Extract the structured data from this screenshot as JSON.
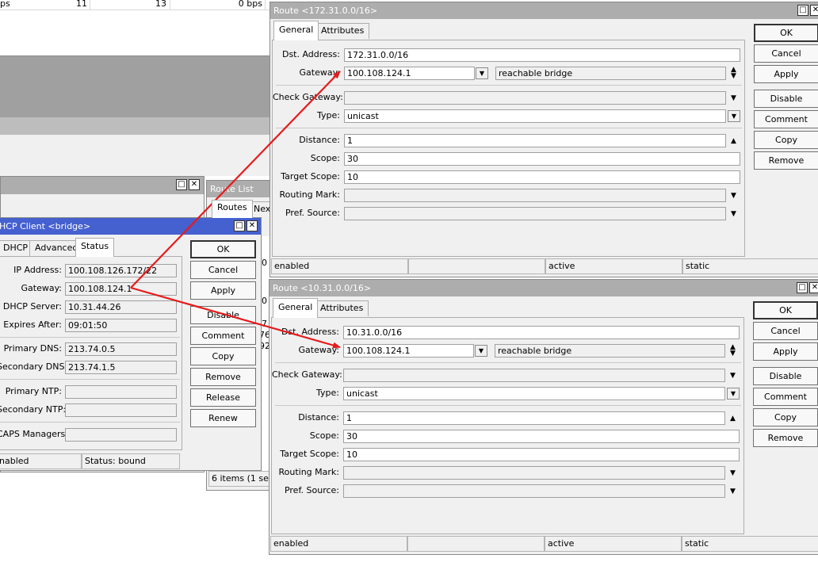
{
  "traffic_row": {
    "unit_tail": "ps",
    "v1": "11",
    "v2": "13",
    "v3": "0 bps"
  },
  "dhcp": {
    "title": "HCP Client <bridge>",
    "tabs": [
      "DHCP",
      "Advanced",
      "Status"
    ],
    "fields": [
      {
        "label": "IP Address:",
        "value": "100.108.126.172/22"
      },
      {
        "label": "Gateway:",
        "value": "100.108.124.1"
      },
      {
        "label": "DHCP Server:",
        "value": "10.31.44.26"
      },
      {
        "label": "Expires After:",
        "value": "09:01:50"
      },
      {
        "label": "Primary DNS:",
        "value": "213.74.0.5"
      },
      {
        "label": "Secondary DNS:",
        "value": "213.74.1.5"
      },
      {
        "label": "Primary NTP:",
        "value": ""
      },
      {
        "label": "Secondary NTP:",
        "value": ""
      },
      {
        "label": "CAPS Managers:",
        "value": ""
      }
    ],
    "buttons": [
      "OK",
      "Cancel",
      "Apply",
      "Disable",
      "Comment",
      "Copy",
      "Remove",
      "Release",
      "Renew"
    ],
    "status_left": "nabled",
    "status_right": "Status: bound"
  },
  "route_list": {
    "title": "Route List",
    "tabs": [
      "Routes",
      "Nex"
    ],
    "frag": [
      "0",
      "0",
      "7",
      "76",
      "92"
    ],
    "status": "6 items (1 selec"
  },
  "route_windows": [
    {
      "title": "Route <172.31.0.0/16>",
      "tabs": [
        "General",
        "Attributes"
      ],
      "dst_label": "Dst. Address:",
      "dst": "172.31.0.0/16",
      "gw_label": "Gateway:",
      "gw": "100.108.124.1",
      "gw_state": "reachable bridge",
      "check_gw_label": "Check Gateway:",
      "check_gw": "",
      "type_label": "Type:",
      "type": "unicast",
      "distance_label": "Distance:",
      "distance": "1",
      "scope_label": "Scope:",
      "scope": "30",
      "target_scope_label": "Target Scope:",
      "target_scope": "10",
      "routing_mark_label": "Routing Mark:",
      "routing_mark": "",
      "pref_source_label": "Pref. Source:",
      "pref_source": "",
      "buttons": [
        "OK",
        "Cancel",
        "Apply",
        "Disable",
        "Comment",
        "Copy",
        "Remove"
      ],
      "status": [
        "enabled",
        "",
        "active",
        "static"
      ]
    },
    {
      "title": "Route <10.31.0.0/16>",
      "tabs": [
        "General",
        "Attributes"
      ],
      "dst_label": "Dst. Address:",
      "dst": "10.31.0.0/16",
      "gw_label": "Gateway:",
      "gw": "100.108.124.1",
      "gw_state": "reachable bridge",
      "check_gw_label": "Check Gateway:",
      "check_gw": "",
      "type_label": "Type:",
      "type": "unicast",
      "distance_label": "Distance:",
      "distance": "1",
      "scope_label": "Scope:",
      "scope": "30",
      "target_scope_label": "Target Scope:",
      "target_scope": "10",
      "routing_mark_label": "Routing Mark:",
      "routing_mark": "",
      "pref_source_label": "Pref. Source:",
      "pref_source": "",
      "buttons": [
        "OK",
        "Cancel",
        "Apply",
        "Disable",
        "Comment",
        "Copy",
        "Remove"
      ],
      "status": [
        "enabled",
        "",
        "active",
        "static"
      ]
    }
  ],
  "colors": {
    "active_title": "#4560cf",
    "inactive_title": "#adadad",
    "annotation_arrow": "#e8191a"
  }
}
